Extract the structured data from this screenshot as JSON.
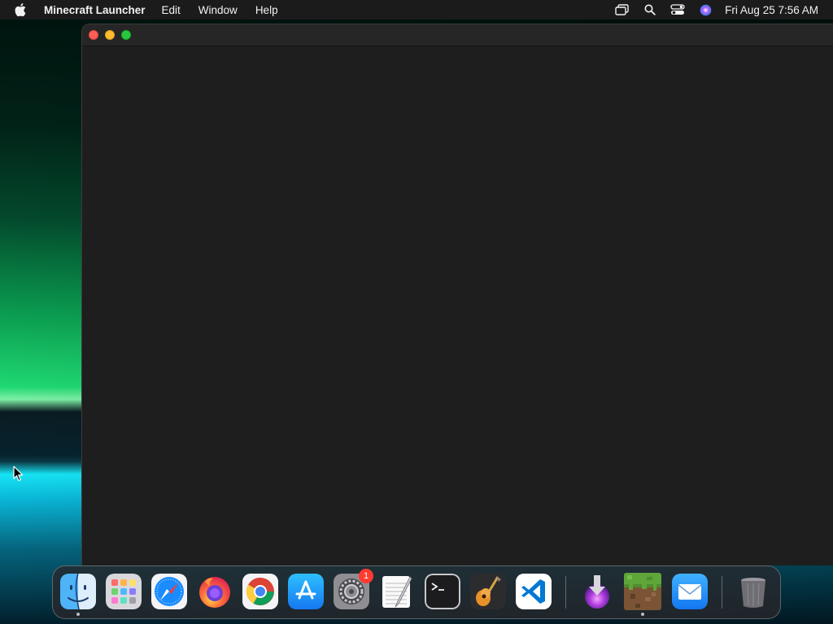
{
  "menubar": {
    "app_name": "Minecraft Launcher",
    "menus": [
      "Edit",
      "Window",
      "Help"
    ],
    "status_icons": [
      "window-switcher-icon",
      "spotlight-search-icon",
      "control-center-icon",
      "siri-icon"
    ],
    "datetime": "Fri Aug 25  7:56 AM"
  },
  "window": {
    "title": ""
  },
  "dock": {
    "items": [
      {
        "name": "Finder",
        "icon": "finder-icon",
        "running": true
      },
      {
        "name": "Launchpad",
        "icon": "launchpad-icon",
        "running": false
      },
      {
        "name": "Safari",
        "icon": "safari-icon",
        "running": false
      },
      {
        "name": "Firefox",
        "icon": "firefox-icon",
        "running": false
      },
      {
        "name": "Google Chrome",
        "icon": "chrome-icon",
        "running": false
      },
      {
        "name": "App Store",
        "icon": "app-store-icon",
        "running": false
      },
      {
        "name": "System Settings",
        "icon": "system-settings-icon",
        "running": false,
        "badge": "1"
      },
      {
        "name": "TextEdit",
        "icon": "textedit-icon",
        "running": false
      },
      {
        "name": "Terminal",
        "icon": "terminal-icon",
        "running": false
      },
      {
        "name": "GarageBand",
        "icon": "garageband-icon",
        "running": false
      },
      {
        "name": "Visual Studio Code",
        "icon": "vscode-icon",
        "running": false
      },
      {
        "name": "Downloads",
        "icon": "downloads-icon",
        "running": false
      },
      {
        "name": "Minecraft Launcher",
        "icon": "minecraft-icon",
        "running": true
      },
      {
        "name": "Mail",
        "icon": "mail-icon",
        "running": false
      },
      {
        "name": "Trash",
        "icon": "trash-icon",
        "running": false
      }
    ]
  },
  "colors": {
    "close": "#fe5f57",
    "minimize": "#febc2e",
    "maximize": "#28c840",
    "window_bg": "#1e1e1e"
  }
}
